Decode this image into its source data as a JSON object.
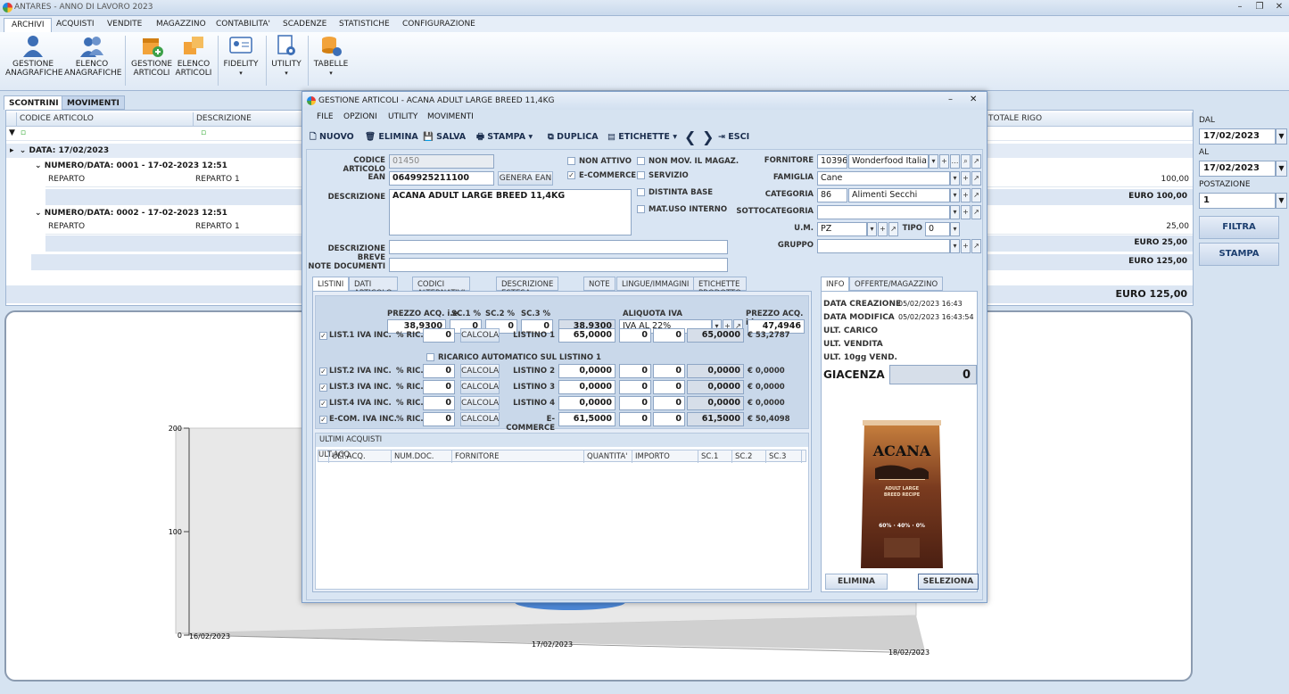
{
  "window": {
    "title": "ANTARES - ANNO DI LAVORO 2023"
  },
  "menu_tabs": [
    "ARCHIVI",
    "ACQUISTI",
    "VENDITE",
    "MAGAZZINO",
    "CONTABILITA'",
    "SCADENZE",
    "STATISTICHE",
    "CONFIGURAZIONE"
  ],
  "ribbon": {
    "gestione_anagrafiche": "GESTIONE\nANAGRAFICHE",
    "elenco_anagrafiche": "ELENCO\nANAGRAFICHE",
    "gestione_articoli": "GESTIONE\nARTICOLI",
    "elenco_articoli": "ELENCO\nARTICOLI",
    "fidelity": "FIDELITY",
    "utility": "UTILITY",
    "tabelle": "TABELLE"
  },
  "sub_tabs": [
    "SCONTRINI",
    "MOVIMENTI"
  ],
  "grid": {
    "headers": [
      "CODICE ARTICOLO",
      "DESCRIZIONE",
      "TOTALE RIGO"
    ],
    "group_date": "DATA: 17/02/2023",
    "groups": [
      {
        "title": "NUMERO/DATA: 0001 - 17-02-2023 12:51",
        "reparto": "REPARTO",
        "reparto_val": "REPARTO 1",
        "rigo": "100,00",
        "total": "EURO 100,00"
      },
      {
        "title": "NUMERO/DATA: 0002 - 17-02-2023 12:51",
        "reparto": "REPARTO",
        "reparto_val": "REPARTO 1",
        "rigo": "25,00",
        "total": "EURO 25,00"
      }
    ],
    "date_total": "EURO 125,00",
    "grand_total": "EURO 125,00"
  },
  "right_panel": {
    "dal_label": "DAL",
    "dal": "17/02/2023",
    "al_label": "AL",
    "al": "17/02/2023",
    "postazione_label": "POSTAZIONE",
    "postazione": "1",
    "filtra": "FILTRA",
    "stampa": "STAMPA"
  },
  "chart_data": {
    "type": "bar",
    "categories": [
      "16/02/2023",
      "17/02/2023",
      "18/02/2023"
    ],
    "values": [
      0,
      125,
      0
    ],
    "y_ticks": [
      "0",
      "100",
      "200"
    ],
    "ylim": [
      0,
      200
    ]
  },
  "dialog": {
    "title": "GESTIONE ARTICOLI - ACANA ADULT LARGE BREED 11,4KG",
    "menu": [
      "FILE",
      "OPZIONI",
      "UTILITY",
      "MOVIMENTI"
    ],
    "toolbar": {
      "nuovo": "NUOVO",
      "elimina": "ELIMINA",
      "salva": "SALVA",
      "stampa": "STAMPA",
      "duplica": "DUPLICA",
      "etichette": "ETICHETTE",
      "esci": "ESCI"
    },
    "labels": {
      "codice": "CODICE ARTICOLO",
      "ean": "EAN",
      "descrizione": "DESCRIZIONE",
      "desc_breve": "DESCRIZIONE BREVE",
      "note_doc": "NOTE DOCUMENTI",
      "fornitore": "FORNITORE",
      "famiglia": "FAMIGLIA",
      "categoria": "CATEGORIA",
      "sottocategoria": "SOTTOCATEGORIA",
      "um": "U.M.",
      "tipo": "TIPO",
      "gruppo": "GRUPPO",
      "genera_ean": "GENERA EAN"
    },
    "values": {
      "codice": "01450",
      "ean": "0649925211100",
      "descrizione": "ACANA ADULT LARGE BREED 11,4KG",
      "fornitore_code": "10396",
      "fornitore_name": "Wonderfood Italia s",
      "famiglia": "Cane",
      "categoria_code": "86",
      "categoria_name": "Alimenti Secchi",
      "um": "PZ",
      "tipo": "0"
    },
    "checks": {
      "non_attivo": "NON ATTIVO",
      "ecommerce": "E-COMMERCE",
      "non_mov": "NON MOV. IL MAGAZ.",
      "servizio": "SERVIZIO",
      "distinta": "DISTINTA BASE",
      "mat_uso": "MAT.USO INTERNO"
    },
    "tabs": [
      "LISTINI",
      "DATI ARTICOLO",
      "CODICI ALTERNATIVI",
      "DESCRIZIONE ESTESA",
      "NOTE",
      "LINGUE/IMMAGINI",
      "ETICHETTE PRODOTTO"
    ],
    "listini": {
      "h_prezzo": "PREZZO ACQ. i.e.",
      "h_sc1": "SC.1 %",
      "h_sc2": "SC.2 %",
      "h_sc3": "SC.3 %",
      "h_aliquota": "ALIQUOTA IVA",
      "h_prezzo_ii": "PREZZO ACQ. i.i.",
      "prezzo": "38,9300",
      "sc1": "0",
      "sc2": "0",
      "sc3": "0",
      "netto": "38,9300",
      "aliquota": "IVA AL 22%",
      "prezzo_ii": "47,4946",
      "ric_label": "% RIC.",
      "calcola": "CALCOLA",
      "ricarico_auto": "RICARICO AUTOMATICO SUL LISTINO 1",
      "rows": [
        {
          "name": "LIST.1 IVA INC.",
          "ric": "0",
          "listino": "LISTINO 1",
          "price": "65,0000",
          "a": "0",
          "b": "0",
          "total": "65,0000",
          "euro": "€ 53,2787"
        },
        {
          "name": "LIST.2 IVA INC.",
          "ric": "0",
          "listino": "LISTINO 2",
          "price": "0,0000",
          "a": "0",
          "b": "0",
          "total": "0,0000",
          "euro": "€ 0,0000"
        },
        {
          "name": "LIST.3 IVA INC.",
          "ric": "0",
          "listino": "LISTINO 3",
          "price": "0,0000",
          "a": "0",
          "b": "0",
          "total": "0,0000",
          "euro": "€ 0,0000"
        },
        {
          "name": "LIST.4 IVA INC.",
          "ric": "0",
          "listino": "LISTINO 4",
          "price": "0,0000",
          "a": "0",
          "b": "0",
          "total": "0,0000",
          "euro": "€ 0,0000"
        },
        {
          "name": "E-COM. IVA INC.",
          "ric": "0",
          "listino": "E-COMMERCE",
          "price": "61,5000",
          "a": "0",
          "b": "0",
          "total": "61,5000",
          "euro": "€ 50,4098"
        }
      ]
    },
    "ultimi": {
      "title": "ULTIMI ACQUISTI",
      "cols": [
        "ULT.ACQ.",
        "NUM.DOC.",
        "FORNITORE",
        "QUANTITA'",
        "IMPORTO",
        "SC.1",
        "SC.2",
        "SC.3"
      ]
    },
    "info_tabs": [
      "INFO",
      "OFFERTE/MAGAZZINO"
    ],
    "info": {
      "creazione_l": "DATA CREAZIONE",
      "creazione": "05/02/2023 16:43",
      "modifica_l": "DATA MODIFICA",
      "modifica": "05/02/2023 16:43:54",
      "carico": "ULT. CARICO",
      "vendita": "ULT. VENDITA",
      "vend10": "ULT. 10gg VEND.",
      "giacenza_l": "GIACENZA",
      "giacenza": "0",
      "elimina": "ELIMINA",
      "seleziona": "SELEZIONA"
    },
    "product_image": {
      "brand": "ACANA",
      "line1": "ADULT LARGE",
      "line2": "BREED RECIPE",
      "percents": "60% · 40% · 0%"
    }
  }
}
